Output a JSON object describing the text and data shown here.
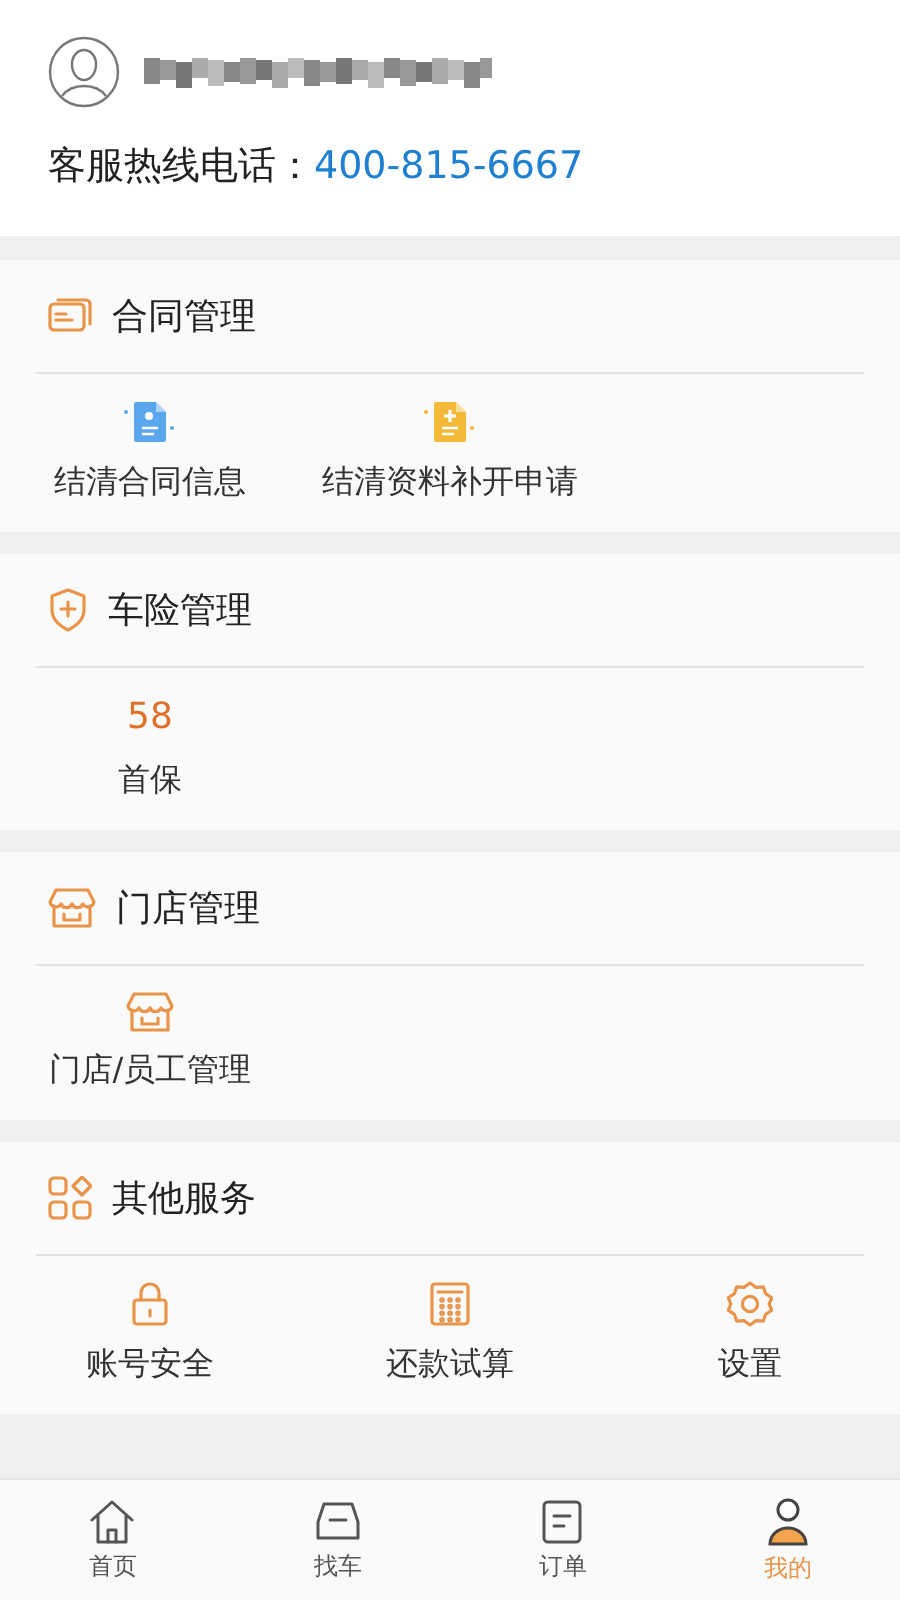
{
  "profile": {
    "hotline_label": "客服热线电话：",
    "hotline_number": "400-815-6667"
  },
  "sections": [
    {
      "title": "合同管理",
      "items": [
        {
          "kind": "link",
          "label": "结清合同信息"
        },
        {
          "kind": "link",
          "label": "结清资料补开申请"
        }
      ]
    },
    {
      "title": "车险管理",
      "items": [
        {
          "kind": "count",
          "count": "58",
          "label": "首保"
        }
      ]
    },
    {
      "title": "门店管理",
      "items": [
        {
          "kind": "link",
          "label": "门店/员工管理"
        }
      ]
    },
    {
      "title": "其他服务",
      "items": [
        {
          "kind": "link",
          "label": "账号安全"
        },
        {
          "kind": "link",
          "label": "还款试算"
        },
        {
          "kind": "link",
          "label": "设置"
        }
      ]
    }
  ],
  "tabs": [
    {
      "label": "首页",
      "selected": false
    },
    {
      "label": "找车",
      "selected": false
    },
    {
      "label": "订单",
      "selected": false
    },
    {
      "label": "我的",
      "selected": true
    }
  ]
}
